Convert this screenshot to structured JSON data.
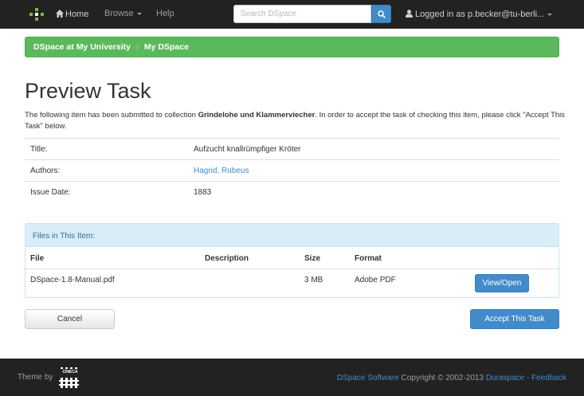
{
  "navbar": {
    "home_label": "Home",
    "browse_label": "Browse",
    "help_label": "Help",
    "search_placeholder": "Search DSpace",
    "user_label": "Logged in as p.becker@tu-berli..."
  },
  "breadcrumb": {
    "items": [
      "DSpace at My University",
      "My DSpace"
    ]
  },
  "page": {
    "title": "Preview Task",
    "intro_before": "The following item has been submitted to collection ",
    "collection": "Grindelohe und Klammerviecher",
    "intro_after": ". In order to accept the task of checking this item, please click \"Accept This Task\" below."
  },
  "metadata": {
    "title_label": "Title:",
    "title_value": "Aufzucht knallrümpfiger Kröter",
    "authors_label": "Authors:",
    "authors_value": "Hagrid, Rubeus",
    "date_label": "Issue Date:",
    "date_value": "1883"
  },
  "files": {
    "heading": "Files in This Item:",
    "col_file": "File",
    "col_description": "Description",
    "col_size": "Size",
    "col_format": "Format",
    "row": {
      "name": "DSpace-1.8-Manual.pdf",
      "description": "",
      "size": "3 MB",
      "format": "Adobe PDF",
      "button": "View/Open"
    }
  },
  "actions": {
    "cancel": "Cancel",
    "accept": "Accept This Task"
  },
  "footer": {
    "theme_by": "Theme by",
    "logo_text": "CINECA",
    "software_link": "DSpace Software",
    "copyright": " Copyright © 2002-2013 ",
    "duraspace_link": "Duraspace",
    "separator": " - ",
    "feedback_link": "Feedback"
  },
  "colors": {
    "navbar": "#222222",
    "breadcrumb": "#5cb85c",
    "primary": "#428bca",
    "panel_heading": "#d9edf7"
  }
}
